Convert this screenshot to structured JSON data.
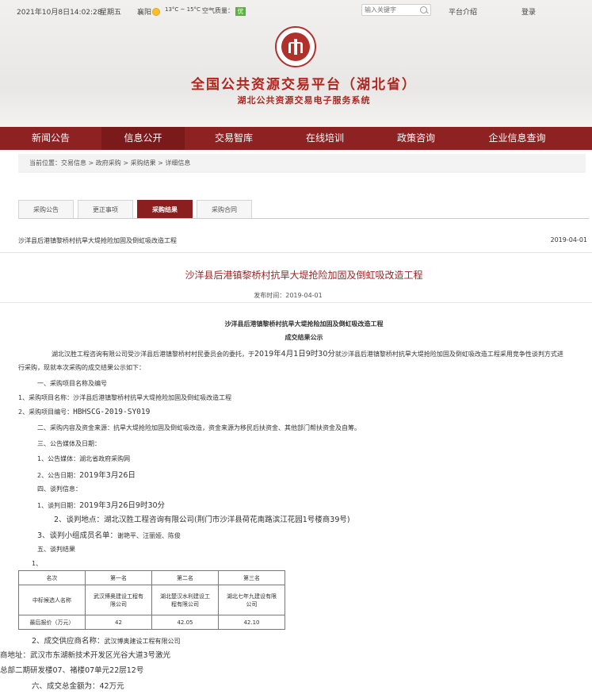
{
  "topbar": {
    "datetime": "2021年10月8日14:02:28",
    "weekday": "星期五",
    "city": "襄阳",
    "weather_icon": "sun-icon",
    "temperature": "13°C ~ 15°C",
    "air_label": "空气质量：",
    "air_badge": "优",
    "search_placeholder": "输入关键字",
    "links": [
      "平台介绍",
      "登录"
    ]
  },
  "header": {
    "site_title": "全国公共资源交易平台（湖北省）",
    "subtitle": "湖北公共资源交易电子服务系统"
  },
  "nav": {
    "items": [
      "新闻公告",
      "信息公开",
      "交易智库",
      "在线培训",
      "政策咨询",
      "企业信息查询"
    ],
    "active": "信息公开"
  },
  "breadcrumb": "当前位置：交易信息 > 政府采购 > 采购结果 > 详细信息",
  "tabs": [
    "采购公告",
    "更正事项",
    "采购结果",
    "采购合同"
  ],
  "active_tab": "采购结果",
  "list": {
    "title": "沙洋县后港镇黎桥村抗旱大堤抢险加固及倒虹吸改造工程",
    "date": "2019-04-01"
  },
  "article": {
    "title": "沙洋县后港镇黎桥村抗旱大堤抢险加固及倒虹吸改造工程",
    "publish_time": "发布时间：2019-04-01",
    "heading": "沙洋县后港镇黎桥村抗旱大堤抢险加固及倒虹吸改造工程",
    "subheading": "成交结果公示",
    "intro_a": "湖北汉胜工程咨询有限公司受沙洋县后港镇黎桥村村民委员会的委托，于",
    "intro_b": "2019年4月1日9时30分",
    "intro_c": "就沙洋县后港镇黎桥村抗旱大堤抢险加固及倒虹吸改造工程采用竞争性谈判方式进",
    "intro_line2": "行采购，现就本次采购的成交结果公示如下：",
    "s1": "一、采购项目名称及编号",
    "s1_1": "1、采购项目名称：沙洋县后港镇黎桥村抗旱大堤抢险加固及倒虹吸改造工程",
    "s1_2_label": "2、采购项目编号：",
    "s1_2_value": "HBHSCG-2019-SY019",
    "s2": "二、采购内容及资金来源：抗旱大堤抢险加固及倒虹吸改造，资金来源为移民后扶资金、其他部门帮扶资金及自筹。",
    "s3": "三、公告媒体及日期：",
    "s3_1": "1、公告媒体：湖北省政府采购网",
    "s3_2_label": "2、公告日期：",
    "s3_2_value": "2019年3月26日",
    "s4": "四、谈判信息：",
    "s4_1_label": "1、谈判日期：",
    "s4_1_value": "2019年3月26日9时30分",
    "s4_2": "2、谈判地点：湖北汉胜工程咨询有限公司(荆门市沙洋县荷花南路滨江花园1号楼商39号)",
    "s4_3_label": "3、谈判小组成员名单：",
    "s4_3_value": "谢艳平、汪丽娅、陈俊",
    "s5": "五、谈判结果",
    "s5_1": "1、",
    "table": {
      "header": [
        "名次",
        "第一名",
        "第二名",
        "第三名"
      ],
      "row_name_label": "中标候选人名称",
      "candidates": [
        [
          "武汉博奥建设工程有",
          "限公司"
        ],
        [
          "湖北楚汉水利建设工",
          "程有限公司"
        ],
        [
          "湖北七年九建设有限",
          "公司"
        ]
      ],
      "row_price_label": "最后报价（万元）",
      "prices": [
        "42",
        "42.05",
        "42.10"
      ]
    },
    "s5_2_label": "2、成交供应商名称：",
    "s5_2_value": "武汉博奥建设工程有限公司",
    "addr_label": "商地址：",
    "addr_value": "武汉市东湖新技术开发区光谷大道3号激光",
    "addr_line2": "总部二期研发楼07、褚楼07单元22层12号",
    "s6": "六、成交总金额为：42万元"
  }
}
